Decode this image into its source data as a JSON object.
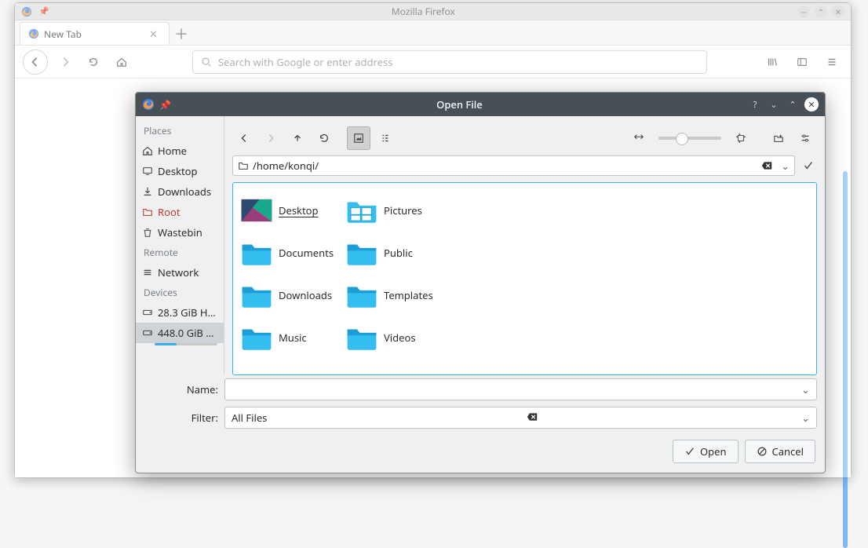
{
  "firefox": {
    "title": "Mozilla Firefox",
    "tab_label": "New Tab",
    "url_placeholder": "Search with Google or enter address"
  },
  "dialog": {
    "title": "Open File",
    "path": "/home/konqi/",
    "name_label": "Name:",
    "name_value": "",
    "filter_label": "Filter:",
    "filter_value": "All Files",
    "open_label": "Open",
    "cancel_label": "Cancel"
  },
  "places": {
    "section_places": "Places",
    "section_remote": "Remote",
    "section_devices": "Devices",
    "items": {
      "home": "Home",
      "desktop": "Desktop",
      "downloads": "Downloads",
      "root": "Root",
      "wastebin": "Wastebin",
      "network": "Network",
      "dev1": "28.3 GiB H…",
      "dev2": "448.0 GiB …"
    }
  },
  "files": [
    {
      "name": "Desktop",
      "kind": "desktop-thumb",
      "selected": true
    },
    {
      "name": "Pictures",
      "kind": "pictures-thumb"
    },
    {
      "name": "Documents",
      "kind": "folder"
    },
    {
      "name": "Public",
      "kind": "folder"
    },
    {
      "name": "Downloads",
      "kind": "folder"
    },
    {
      "name": "Templates",
      "kind": "folder"
    },
    {
      "name": "Music",
      "kind": "folder"
    },
    {
      "name": "Videos",
      "kind": "folder"
    }
  ]
}
